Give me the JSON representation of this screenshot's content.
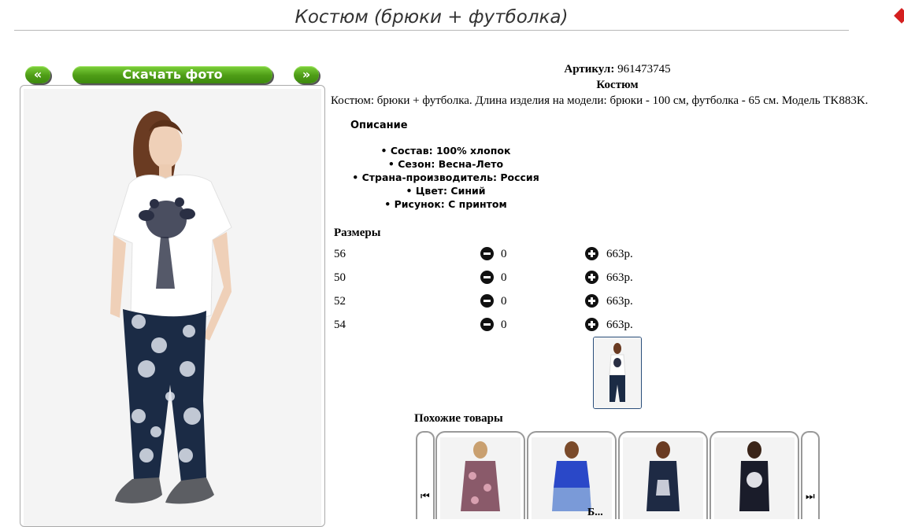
{
  "page": {
    "title": "Костюм (брюки + футболка)"
  },
  "gallery": {
    "prev_label": "«",
    "download_label": "Скачать фото",
    "next_label": "»"
  },
  "product": {
    "article_label": "Артикул:",
    "article_value": "961473745",
    "kind": "Костюм",
    "description": "Костюм: брюки + футболка. Длина изделия на модели: брюки - 100 см, футболка - 65 см. Модель TK883K.",
    "description_heading": "Описание",
    "specs": [
      "• Состав: 100% хлопок",
      "• Сезон: Весна-Лето",
      "• Страна-производитель: Россия",
      "• Цвет: Синий",
      "• Рисунок: С принтом"
    ]
  },
  "sizes": {
    "heading": "Размеры",
    "rows": [
      {
        "size": "56",
        "qty": "0",
        "price": "663р."
      },
      {
        "size": "50",
        "qty": "0",
        "price": "663р."
      },
      {
        "size": "52",
        "qty": "0",
        "price": "663р."
      },
      {
        "size": "54",
        "qty": "0",
        "price": "663р."
      }
    ]
  },
  "similar": {
    "heading": "Похожие товары",
    "left_icon": "skip-back-icon",
    "right_icon": "skip-forward-icon",
    "bottom_text": "Б..."
  },
  "colors": {
    "accent_green": "#5aa81e",
    "thumb_border": "#2a4e7a",
    "pants_navy": "#1b2b45"
  }
}
